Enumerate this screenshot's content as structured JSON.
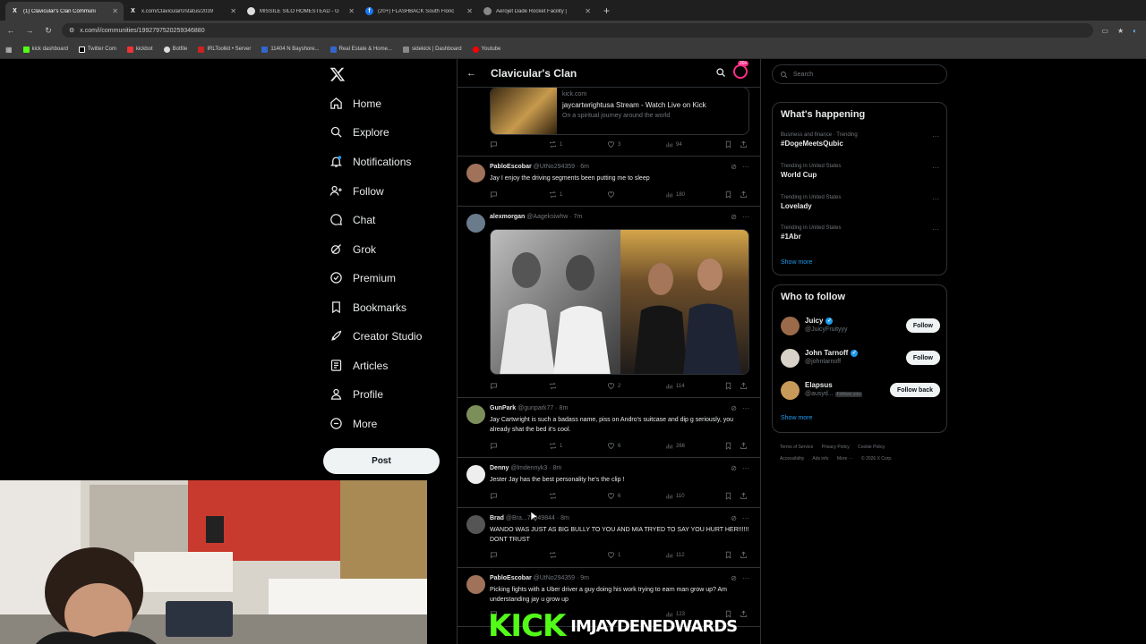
{
  "browser": {
    "tabs": [
      {
        "title": "(1) Clavicular's Clan Communi",
        "icon": "x-logo",
        "active": true
      },
      {
        "title": "x.com/Clavicular0/status/2039",
        "icon": "x-logo",
        "active": false
      },
      {
        "title": "MISSILE SILO HOMESTEAD - G",
        "icon": "globe",
        "active": false
      },
      {
        "title": "(20+) FLASHBACK South Floric",
        "icon": "facebook",
        "active": false
      },
      {
        "title": "Aerojet Dade Rocket Facility |",
        "icon": "globe",
        "active": false
      }
    ],
    "url": "x.com/i/communities/1992797520259346880",
    "bookmarks": [
      "kick dashboard",
      "Twitter Com",
      "kickbot",
      "Botfile",
      "IRLToolkit • Server",
      "11404 N Bayshore...",
      "Real Estate & Home...",
      "sidekick | Dashboard",
      "Youtube"
    ]
  },
  "nav": {
    "items": [
      {
        "label": "Home",
        "icon": "home-icon"
      },
      {
        "label": "Explore",
        "icon": "search-icon"
      },
      {
        "label": "Notifications",
        "icon": "bell-icon"
      },
      {
        "label": "Follow",
        "icon": "follow-icon"
      },
      {
        "label": "Chat",
        "icon": "chat-icon"
      },
      {
        "label": "Grok",
        "icon": "grok-icon"
      },
      {
        "label": "Premium",
        "icon": "premium-icon"
      },
      {
        "label": "Bookmarks",
        "icon": "bookmark-icon"
      },
      {
        "label": "Creator Studio",
        "icon": "rocket-icon"
      },
      {
        "label": "Articles",
        "icon": "articles-icon"
      },
      {
        "label": "Profile",
        "icon": "profile-icon"
      },
      {
        "label": "More",
        "icon": "more-icon"
      }
    ],
    "post_label": "Post"
  },
  "feed": {
    "title": "Clavicular's Clan",
    "notif_badge": "20+",
    "link_card": {
      "domain": "kick.com",
      "title": "jaycartwrightusa Stream - Watch Live on Kick",
      "description": "On a spiritual journey around the world",
      "stats": {
        "replies": "",
        "reposts": "1",
        "likes": "3",
        "views": "94"
      }
    },
    "posts": [
      {
        "name": "PabloEscobar",
        "handle": "@UtNo294359 · 6m",
        "text": "Jay I enjoy the driving segments been putting me to sleep",
        "stats": {
          "replies": "",
          "reposts": "1",
          "likes": "",
          "views": "180"
        }
      },
      {
        "name": "alexmorgan",
        "handle": "@Aageksiwhw · 7m",
        "text": "",
        "stats": {
          "replies": "",
          "reposts": "",
          "likes": "2",
          "views": "114"
        }
      },
      {
        "name": "GunPark",
        "handle": "@gunpark77 · 8m",
        "text": "Jay Cartwright is such a badass name, piss on Andro's suitcase and dip g seriously, you already shat the bed it's cool.",
        "stats": {
          "replies": "",
          "reposts": "1",
          "likes": "6",
          "views": "266"
        }
      },
      {
        "name": "Denny",
        "handle": "@lmdennyk3 · 8m",
        "text": "Jester Jay has the best personality he's the clip !",
        "stats": {
          "replies": "",
          "reposts": "",
          "likes": "6",
          "views": "110"
        }
      },
      {
        "name": "Brad",
        "handle": "@Bra...78349844 · 8m",
        "text": "WANDO WAS JUST AS BIG BULLY TO YOU AND MIA TRYED TO SAY YOU HURT HER!!!!!! DONT TRUST",
        "stats": {
          "replies": "",
          "reposts": "",
          "likes": "1",
          "views": "112"
        }
      },
      {
        "name": "PabloEscobar",
        "handle": "@UtNo294359 · 9m",
        "text": "Picking fights with a Uber driver a guy doing his work trying to earn man grow up? Am understanding jay u grow up",
        "stats": {
          "replies": "",
          "reposts": "",
          "likes": "",
          "views": "123"
        }
      }
    ]
  },
  "sidebar": {
    "search_placeholder": "Search",
    "happening": {
      "title": "What's happening",
      "trends": [
        {
          "category": "Business and finance · Trending",
          "title": "#DogeMeetsQubic"
        },
        {
          "category": "Trending in United States",
          "title": "World Cup"
        },
        {
          "category": "Trending in United States",
          "title": "Lovelady"
        },
        {
          "category": "Trending in United States",
          "title": "#1Abr"
        }
      ],
      "show_more": "Show more"
    },
    "who_to_follow": {
      "title": "Who to follow",
      "people": [
        {
          "name": "Juicy",
          "handle": "@JuicyFruityyy",
          "button": "Follow",
          "verified": true
        },
        {
          "name": "John Tarnoff",
          "handle": "@johntarnoff",
          "button": "Follow",
          "verified": true
        },
        {
          "name": "Elapsus",
          "handle": "@ausyd...",
          "follows_you": "Follows you",
          "button": "Follow back",
          "verified": false
        }
      ],
      "show_more": "Show more"
    },
    "footer": [
      "Terms of Service",
      "Privacy Policy",
      "Cookie Policy",
      "Accessibility",
      "Ads info",
      "More ···",
      "© 2026 X Corp."
    ]
  },
  "overlay": {
    "kick_logo": "KICK",
    "channel": "IMJAYDENEDWARDS"
  },
  "colors": {
    "accent": "#1d9bf0",
    "kick_green": "#53fc18",
    "badge_pink": "#ff2d87"
  }
}
